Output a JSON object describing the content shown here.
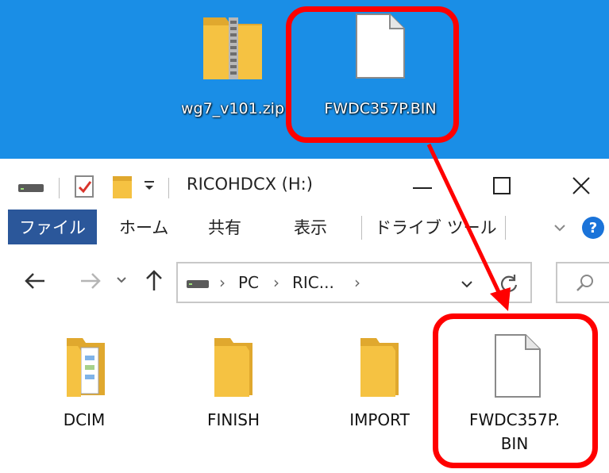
{
  "desktop": {
    "icons": [
      {
        "label": "wg7_v101.zip",
        "icon": "zip-folder-icon"
      },
      {
        "label": "FWDC357P.BIN",
        "icon": "file-icon"
      }
    ]
  },
  "explorer": {
    "title": "RICOHDCX (H:)",
    "ribbon_tabs": {
      "file": "ファイル",
      "home": "ホーム",
      "share": "共有",
      "view": "表示",
      "drive_tools": "ドライブ ツール"
    },
    "breadcrumb": {
      "pc": "PC",
      "drive": "RIC..."
    },
    "items": [
      {
        "label": "DCIM",
        "icon": "folder-with-files-icon"
      },
      {
        "label": "FINISH",
        "icon": "folder-icon"
      },
      {
        "label": "IMPORT",
        "icon": "folder-icon"
      },
      {
        "label_line1": "FWDC357P.",
        "label_line2": "BIN",
        "icon": "file-icon"
      }
    ]
  },
  "colors": {
    "desktop": "#1a8ee6",
    "highlight": "#ff0000",
    "file_tab": "#2b579a",
    "folder": "#f5c242"
  }
}
